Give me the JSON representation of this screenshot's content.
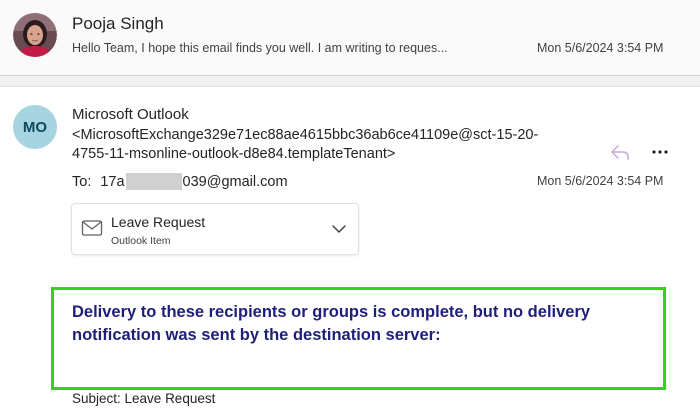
{
  "thread": {
    "first_message": {
      "sender": "Pooja Singh",
      "preview": "Hello Team, I hope this email finds you well. I am writing to reques...",
      "date": "Mon 5/6/2024 3:54 PM"
    },
    "second_message": {
      "avatar_initials": "MO",
      "avatar_color": "#a6d5e1",
      "sender": "Microsoft Outlook",
      "address": "<MicrosoftExchange329e71ec88ae4615bbc36ab6ce41109e@sct-15-20-4755-11-msonline-outlook-d8e84.templateTenant>",
      "to_label": "To:",
      "to_prefix": "17a",
      "to_suffix": "039@gmail.com",
      "date": "Mon 5/6/2024 3:54 PM",
      "attachment": {
        "title": "Leave Request",
        "type": "Outlook Item",
        "icon": "envelope-icon"
      },
      "notice": "Delivery to these recipients or groups is complete, but no delivery notification was sent by the destination server:",
      "notice_border_color": "#2fd617",
      "subject_line": "Subject: Leave Request"
    },
    "actions": {
      "reply_icon": "reply-arrow-icon",
      "more_icon": "more-horizontal-icon"
    }
  }
}
